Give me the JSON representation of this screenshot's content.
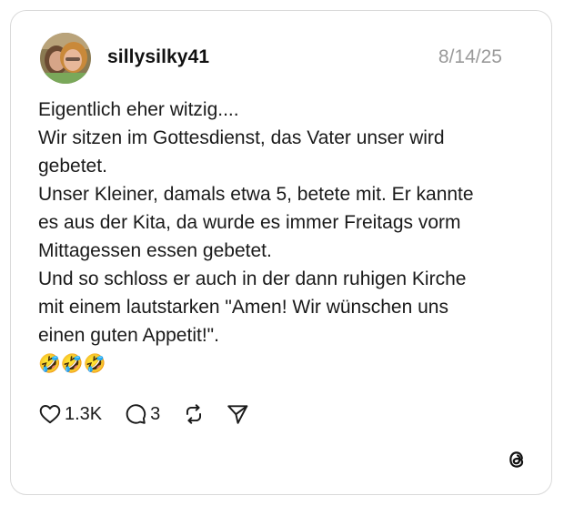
{
  "post": {
    "username": "sillysilky41",
    "date": "8/14/25",
    "lines": [
      "Eigentlich eher witzig....",
      "Wir sitzen im Gottesdienst, das Vater unser wird",
      "gebetet.",
      "Unser Kleiner, damals etwa 5, betete mit. Er kannte",
      "es aus der Kita, da wurde es immer Freitags vorm",
      "Mittagessen essen gebetet.",
      "Und so schloss er auch in der dann ruhigen Kirche",
      "mit einem lautstarken \"Amen! Wir wünschen uns",
      "einen guten Appetit!\"."
    ],
    "emojis": "🤣🤣🤣"
  },
  "actions": {
    "like_count": "1.3K",
    "reply_count": "3"
  },
  "icons": {
    "like": "heart-icon",
    "reply": "comment-bubble-icon",
    "repost": "repost-icon",
    "share": "send-icon",
    "brand": "threads-logo-icon"
  },
  "colors": {
    "text": "#1a1a1a",
    "date": "#9a9a9a",
    "border": "#d9d9d9"
  }
}
